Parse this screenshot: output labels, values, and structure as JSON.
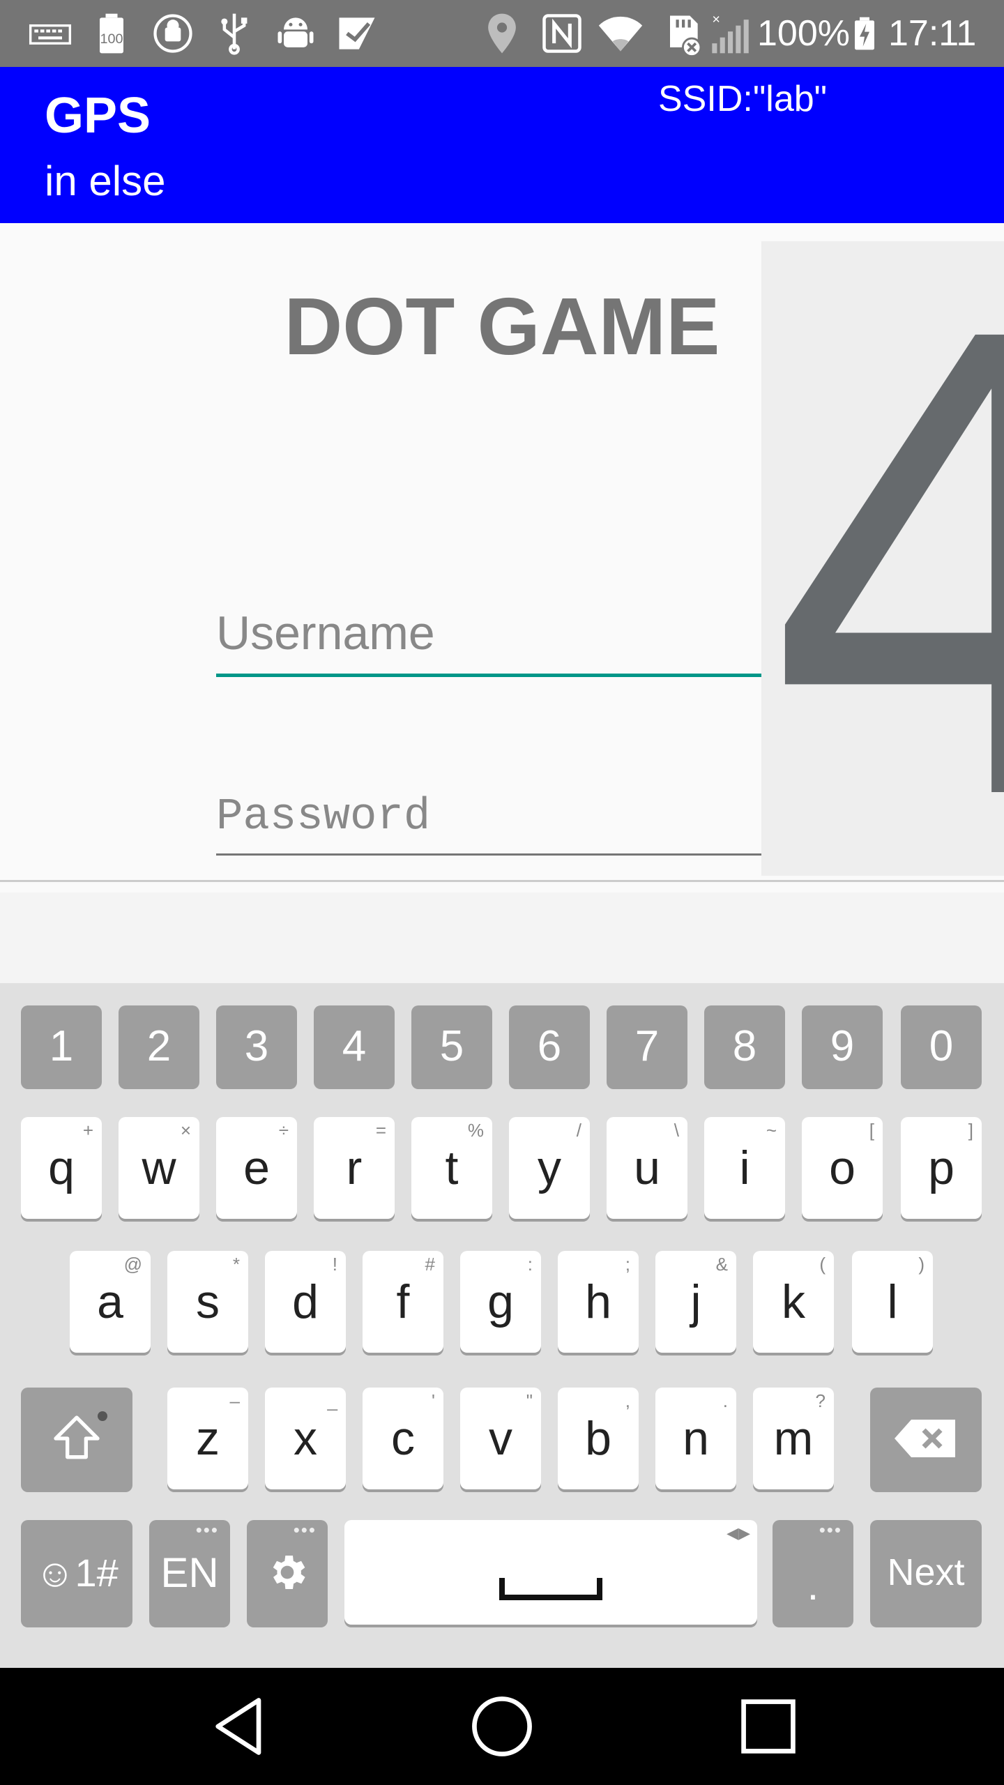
{
  "status_bar": {
    "icons": [
      "keyboard-icon",
      "battery-100-icon",
      "android-sync-icon",
      "usb-icon",
      "android-debug-icon",
      "checkmark-app-icon",
      "location-icon",
      "nfc-icon",
      "wifi-icon",
      "sd-card-error-icon",
      "cell-signal-icon",
      "battery-charging-icon"
    ],
    "battery_percent": "100%",
    "time": "17:11"
  },
  "app_bar": {
    "title": "GPS",
    "subtitle": "in else",
    "ssid": "SSID:\"lab\""
  },
  "main": {
    "title": "DOT GAME",
    "username_placeholder": "Username",
    "password_placeholder": "Password",
    "countdown": "4"
  },
  "keyboard": {
    "numbers": [
      "1",
      "2",
      "3",
      "4",
      "5",
      "6",
      "7",
      "8",
      "9",
      "0"
    ],
    "row1": [
      {
        "key": "q",
        "hint": "+"
      },
      {
        "key": "w",
        "hint": "×"
      },
      {
        "key": "e",
        "hint": "÷"
      },
      {
        "key": "r",
        "hint": "="
      },
      {
        "key": "t",
        "hint": "%"
      },
      {
        "key": "y",
        "hint": "/"
      },
      {
        "key": "u",
        "hint": "\\"
      },
      {
        "key": "i",
        "hint": "~"
      },
      {
        "key": "o",
        "hint": "["
      },
      {
        "key": "p",
        "hint": "]"
      }
    ],
    "row2": [
      {
        "key": "a",
        "hint": "@"
      },
      {
        "key": "s",
        "hint": "*"
      },
      {
        "key": "d",
        "hint": "!"
      },
      {
        "key": "f",
        "hint": "#"
      },
      {
        "key": "g",
        "hint": ":"
      },
      {
        "key": "h",
        "hint": ";"
      },
      {
        "key": "j",
        "hint": "&"
      },
      {
        "key": "k",
        "hint": "("
      },
      {
        "key": "l",
        "hint": ")"
      }
    ],
    "row3": [
      {
        "key": "z",
        "hint": "–"
      },
      {
        "key": "x",
        "hint": "_"
      },
      {
        "key": "c",
        "hint": "'"
      },
      {
        "key": "v",
        "hint": "\""
      },
      {
        "key": "b",
        "hint": ","
      },
      {
        "key": "n",
        "hint": "."
      },
      {
        "key": "m",
        "hint": "?"
      }
    ],
    "symbols_label": "☺1#",
    "language_label": "EN",
    "period_label": ".",
    "next_label": "Next"
  },
  "nav_bar": {
    "icons": [
      "back-icon",
      "home-icon",
      "recents-icon"
    ]
  }
}
